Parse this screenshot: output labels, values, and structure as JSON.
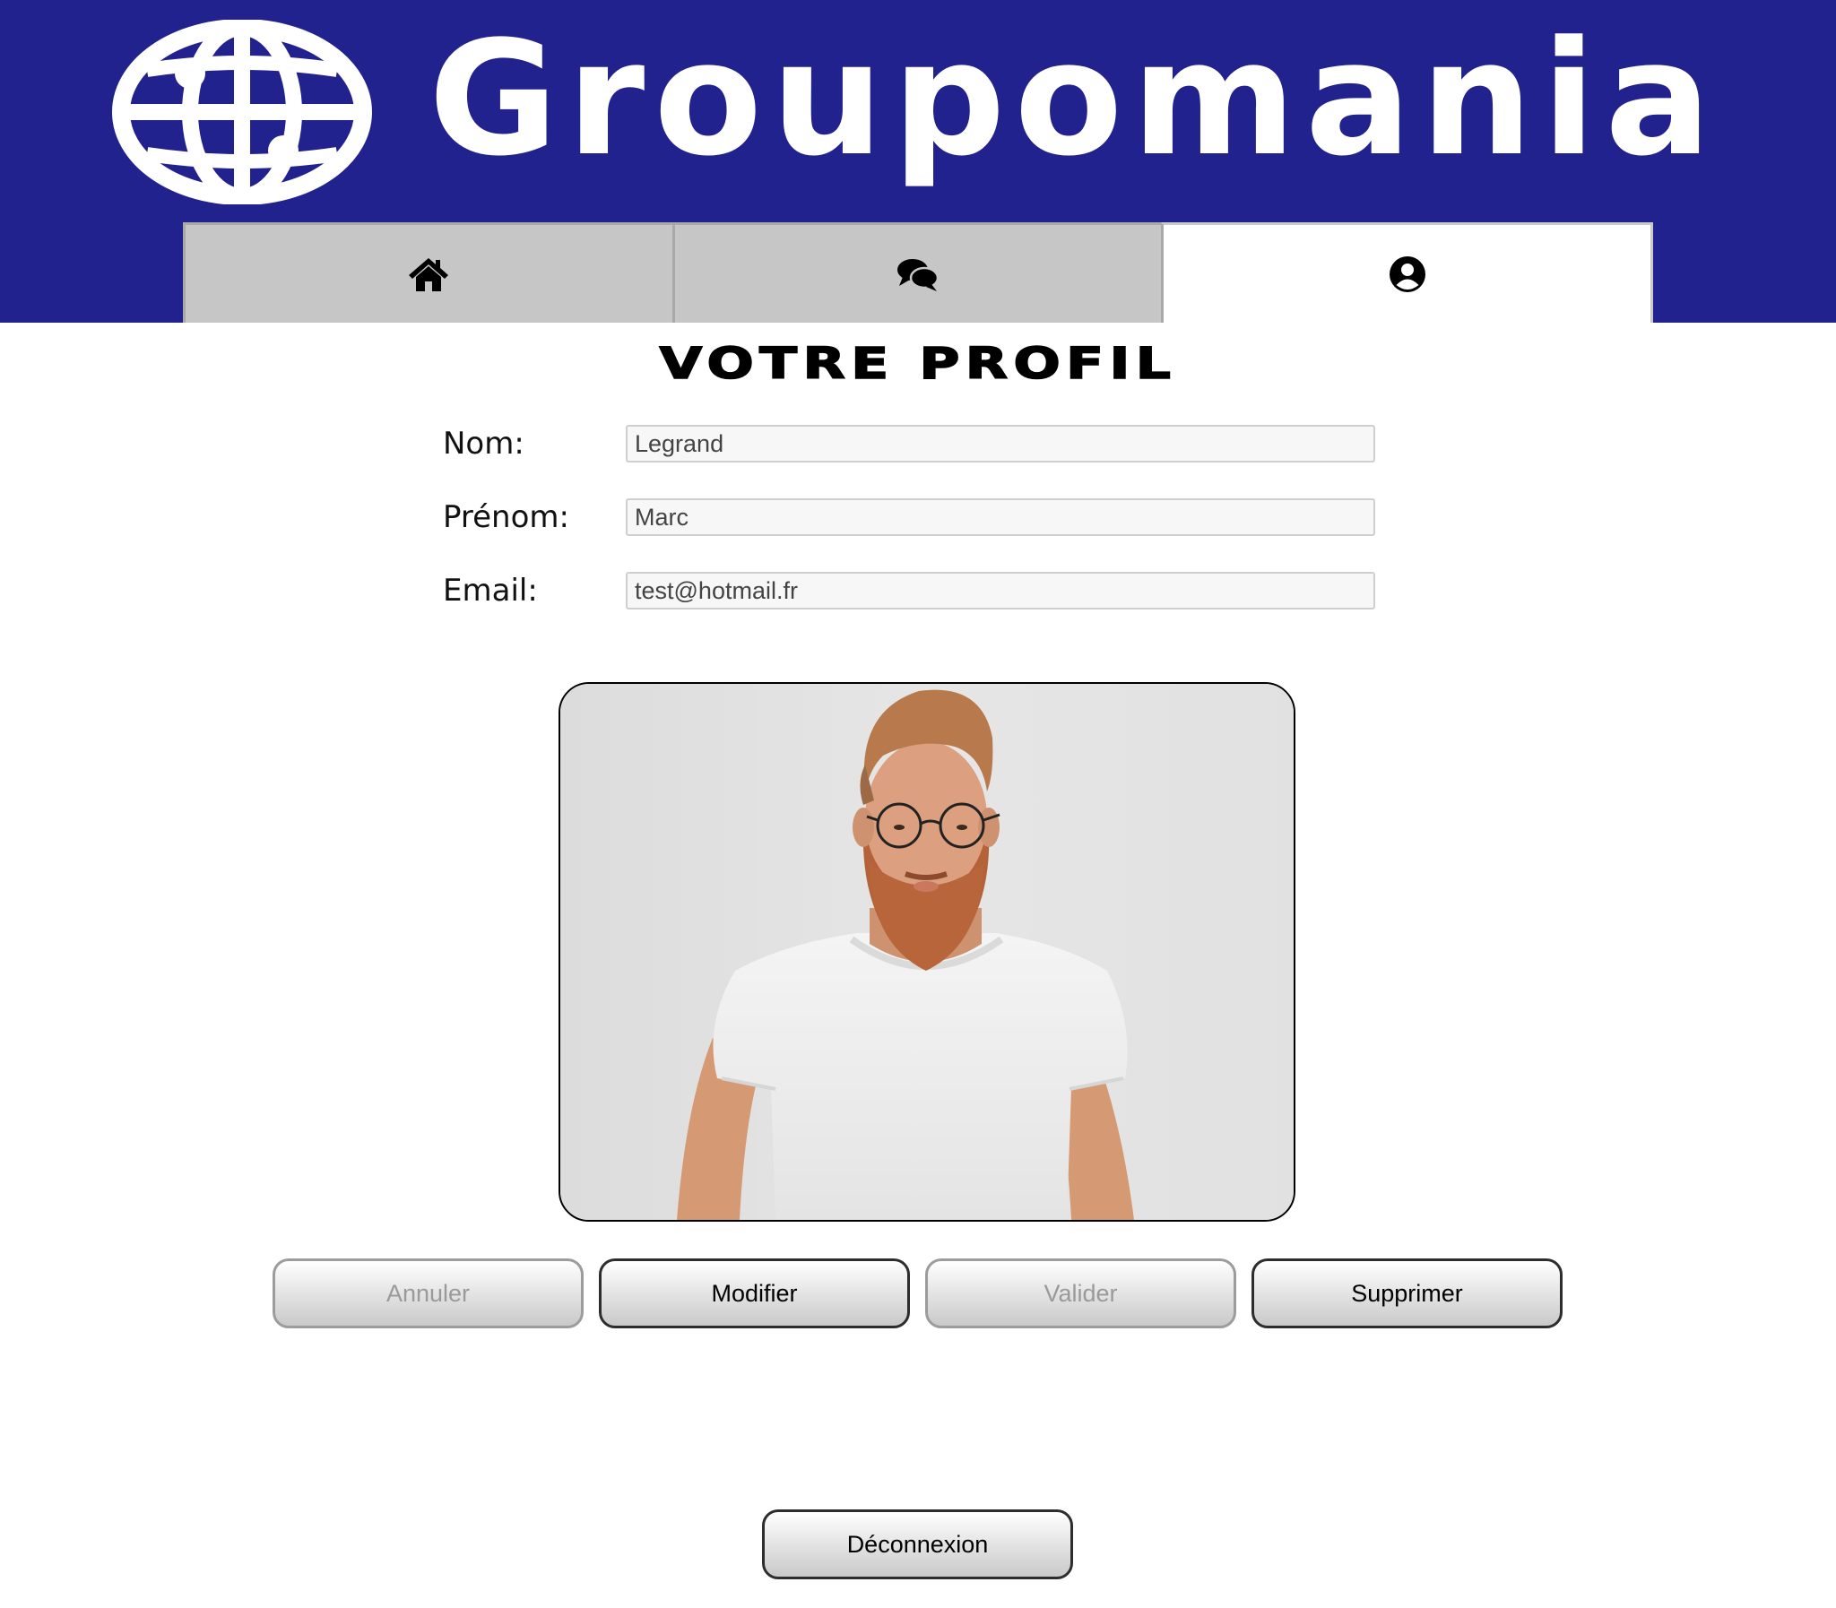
{
  "header": {
    "brand": "Groupomania",
    "background_color": "#21228e",
    "logo_icon": "globe-icon"
  },
  "nav": {
    "tabs": [
      {
        "icon": "home-icon",
        "active": false
      },
      {
        "icon": "comments-icon",
        "active": false
      },
      {
        "icon": "user-circle-icon",
        "active": true
      }
    ]
  },
  "profile": {
    "title": "VOTRE PROFIL",
    "fields": {
      "nom": {
        "label": "Nom:",
        "value": "Legrand"
      },
      "prenom": {
        "label": "Prénom:",
        "value": "Marc"
      },
      "email": {
        "label": "Email:",
        "value": "test@hotmail.fr"
      }
    },
    "photo": "profile-photo-bearded-man"
  },
  "actions": {
    "annuler": "Annuler",
    "modifier": "Modifier",
    "valider": "Valider",
    "supprimer": "Supprimer",
    "deconnexion": "Déconnexion"
  }
}
